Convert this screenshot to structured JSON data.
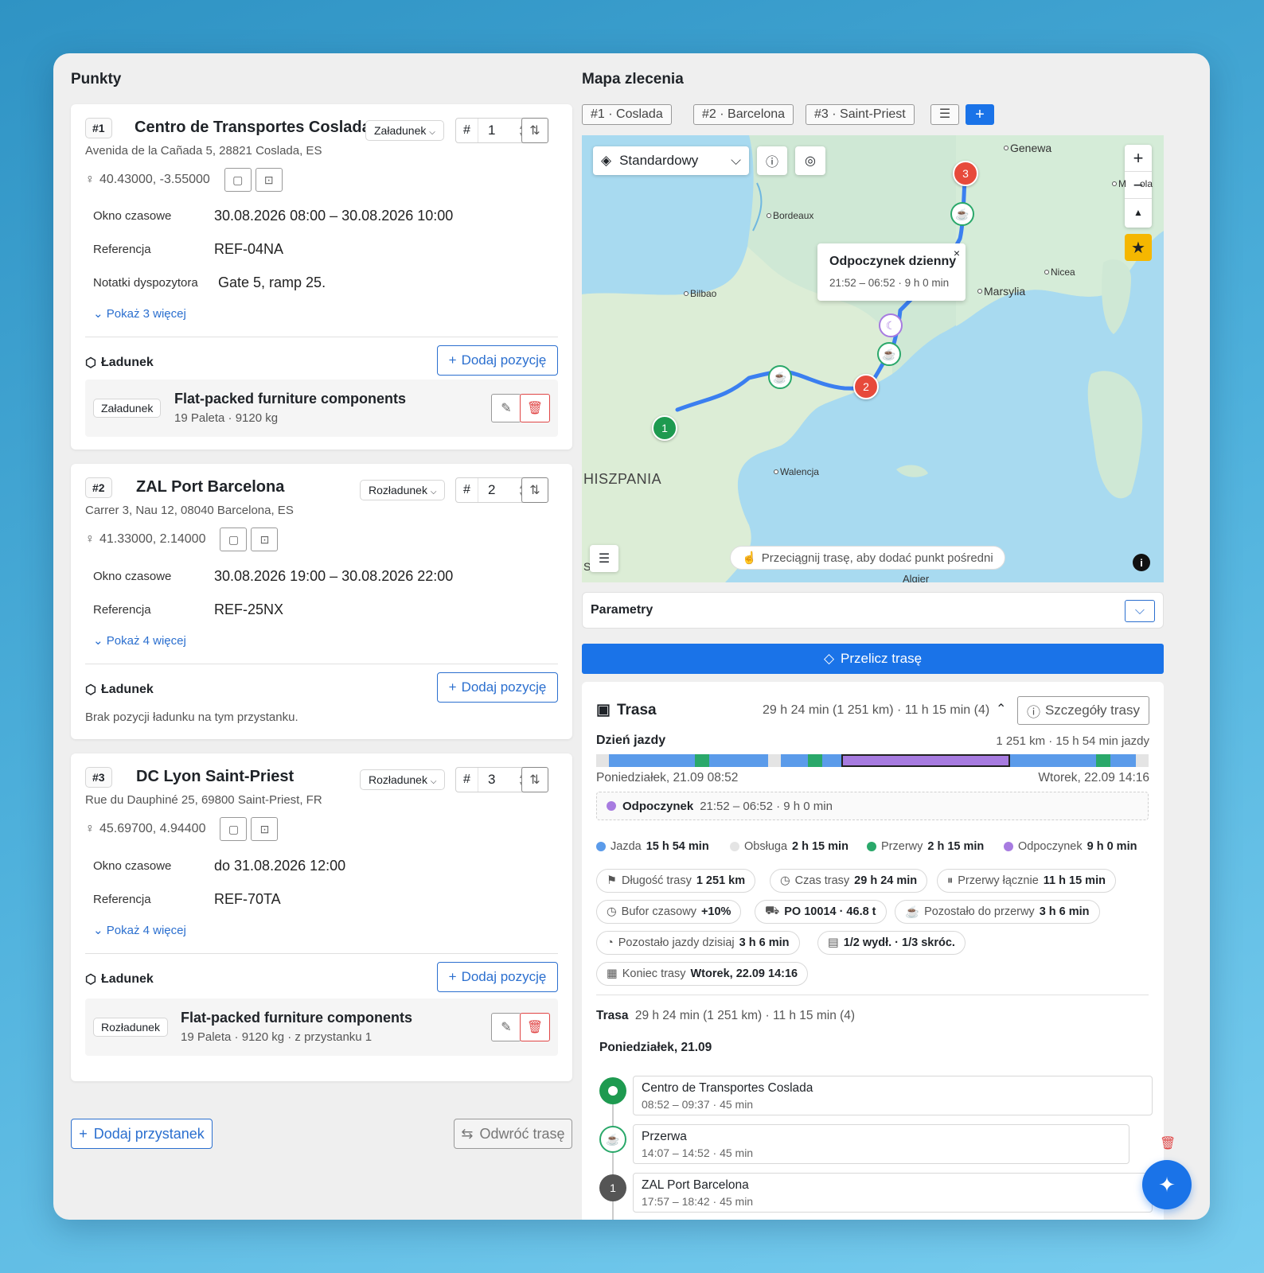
{
  "left": {
    "title": "Punkty",
    "points": [
      {
        "num": "#1",
        "name": "Centro de Transportes Coslada",
        "type": "Załadunek",
        "order": "1",
        "address": "Avenida de la Cañada 5, 28821 Coslada, ES",
        "coords": "40.43000, -3.55000",
        "fields": [
          {
            "label": "Okno czasowe",
            "value": "30.08.2026 08:00 – 30.08.2026 10:00"
          },
          {
            "label": "Referencja",
            "value": "REF-04NA"
          },
          {
            "label": "Notatki dyspozytora",
            "value": "Gate 5, ramp 25."
          }
        ],
        "more": "Pokaż 3 więcej",
        "cargo_title": "Ładunek",
        "add_label": "Dodaj pozycję",
        "item": {
          "tag": "Załadunek",
          "title": "Flat-packed furniture components",
          "sub": "19 Paleta · 9120 kg"
        }
      },
      {
        "num": "#2",
        "name": "ZAL Port Barcelona",
        "type": "Rozładunek",
        "order": "2",
        "address": "Carrer 3, Nau 12, 08040 Barcelona, ES",
        "coords": "41.33000, 2.14000",
        "fields": [
          {
            "label": "Okno czasowe",
            "value": "30.08.2026 19:00 – 30.08.2026 22:00"
          },
          {
            "label": "Referencja",
            "value": "REF-25NX"
          }
        ],
        "more": "Pokaż 4 więcej",
        "cargo_title": "Ładunek",
        "add_label": "Dodaj pozycję",
        "empty": "Brak pozycji ładunku na tym przystanku."
      },
      {
        "num": "#3",
        "name": "DC Lyon Saint-Priest",
        "type": "Rozładunek",
        "order": "3",
        "address": "Rue du Dauphiné 25, 69800 Saint-Priest, FR",
        "coords": "45.69700, 4.94400",
        "fields": [
          {
            "label": "Okno czasowe",
            "value": "do 31.08.2026 12:00"
          },
          {
            "label": "Referencja",
            "value": "REF-70TA"
          }
        ],
        "more": "Pokaż 4 więcej",
        "cargo_title": "Ładunek",
        "add_label": "Dodaj pozycję",
        "item": {
          "tag": "Rozładunek",
          "title": "Flat-packed furniture components",
          "sub": "19 Paleta · 9120 kg · z przystanku 1"
        }
      }
    ],
    "add_stop": "Dodaj przystanek",
    "reverse": "Odwróć trasę"
  },
  "right": {
    "title": "Mapa zlecenia",
    "tabs": [
      "#1 · Coslada",
      "#2 · Barcelona",
      "#3 · Saint-Priest"
    ],
    "map": {
      "layer": "Standardowy",
      "popup_title": "Odpoczynek dzienny",
      "popup_sub": "21:52 – 06:52 · 9 h 0 min",
      "hint": "Przeciągnij trasę, aby dodać punkt pośredni",
      "cities": {
        "genewa": "Genewa",
        "bordeaux": "Bordeaux",
        "bilbao": "Bilbao",
        "marsylia": "Marsylia",
        "nicea": "Nicea",
        "walencja": "Walencja",
        "hiszpania": "HISZPANIA",
        "algier": "Algier",
        "s": "S",
        "mla": "ola",
        "m": "M"
      },
      "markers": [
        "1",
        "2",
        "3"
      ]
    },
    "params": "Parametry",
    "recalc": "Przelicz trasę",
    "route": {
      "title": "Trasa",
      "summary": "29 h 24 min (1 251 km) · 11 h 15 min (4)",
      "details": "Szczegóły trasy",
      "day_label": "Dzień jazdy",
      "day_stats": "1 251 km · 15 h 54 min jazdy",
      "start": "Poniedziałek, 21.09 08:52",
      "end": "Wtorek, 22.09 14:16",
      "rest_label": "Odpoczynek",
      "rest_time": "21:52 – 06:52 · 9 h 0 min",
      "legend": [
        {
          "label": "Jazda",
          "value": "15 h 54 min",
          "color": "#5b9bea"
        },
        {
          "label": "Obsługa",
          "value": "2 h 15 min",
          "color": "#e4e4e4"
        },
        {
          "label": "Przerwy",
          "value": "2 h 15 min",
          "color": "#2aa86a"
        },
        {
          "label": "Odpoczynek",
          "value": "9 h 0 min",
          "color": "#a77be0"
        }
      ],
      "chips": [
        {
          "label": "Długość trasy",
          "value": "1 251 km",
          "icon": "signpost-icon"
        },
        {
          "label": "Czas trasy",
          "value": "29 h 24 min",
          "icon": "clock-icon"
        },
        {
          "label": "Przerwy łącznie",
          "value": "11 h 15 min",
          "icon": "pause-icon"
        },
        {
          "label": "Bufor czasowy",
          "value": "+10%",
          "icon": "timer-icon"
        },
        {
          "label": "",
          "value": "PO 10014 · 46.8 t",
          "icon": "truck-icon"
        },
        {
          "label": "Pozostało do przerwy",
          "value": "3 h 6 min",
          "icon": "coffee-icon"
        },
        {
          "label": "Pozostało jazdy dzisiaj",
          "value": "3 h 6 min",
          "icon": "gauge-icon"
        },
        {
          "label": "",
          "value": "1/2 wydł. · 1/3 skróc.",
          "icon": "card-icon"
        },
        {
          "label": "Koniec trasy",
          "value": "Wtorek, 22.09 14:16",
          "icon": "calendar-icon"
        }
      ],
      "trasa_label": "Trasa",
      "trasa_summary": "29 h 24 min (1 251 km) · 11 h 15 min (4)",
      "day_header": "Poniedziałek, 21.09",
      "timeline": [
        {
          "title": "Centro de Transportes Coslada",
          "time": "08:52 – 09:37 · 45 min"
        },
        {
          "title": "Przerwa",
          "time": "14:07 – 14:52 · 45 min"
        },
        {
          "title": "ZAL Port Barcelona",
          "time": "17:57 – 18:42 · 45 min",
          "badge": "1"
        }
      ]
    }
  }
}
